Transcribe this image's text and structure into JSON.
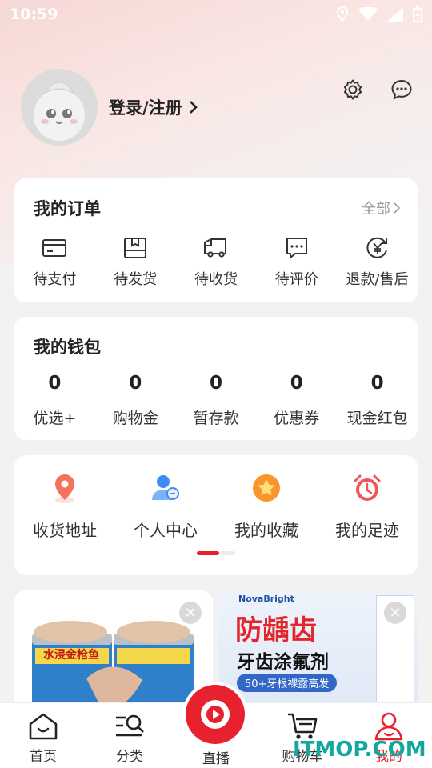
{
  "status": {
    "time": "10:59"
  },
  "profile": {
    "login_label": "登录/注册"
  },
  "orders": {
    "title": "我的订单",
    "all_label": "全部",
    "items": [
      {
        "label": "待支付",
        "icon": "wallet-card-icon"
      },
      {
        "label": "待发货",
        "icon": "package-box-icon"
      },
      {
        "label": "待收货",
        "icon": "truck-icon"
      },
      {
        "label": "待评价",
        "icon": "comment-icon"
      },
      {
        "label": "退款/售后",
        "icon": "refund-yen-icon"
      }
    ]
  },
  "wallet": {
    "title": "我的钱包",
    "items": [
      {
        "value": "0",
        "label": "优选+"
      },
      {
        "value": "0",
        "label": "购物金"
      },
      {
        "value": "0",
        "label": "暂存款"
      },
      {
        "value": "0",
        "label": "优惠券"
      },
      {
        "value": "0",
        "label": "现金红包"
      }
    ]
  },
  "shortcuts": {
    "items": [
      {
        "label": "收货地址",
        "icon": "location-pin-icon"
      },
      {
        "label": "个人中心",
        "icon": "user-profile-icon"
      },
      {
        "label": "我的收藏",
        "icon": "star-favorite-icon"
      },
      {
        "label": "我的足迹",
        "icon": "alarm-clock-icon"
      }
    ]
  },
  "products": [
    {
      "title_text": "水浸金枪鱼"
    },
    {
      "brand": "NovaBright",
      "headline": "防龋齿",
      "sub": "牙齿涂氟剂",
      "tag": "50+牙根裸露高发"
    }
  ],
  "tabbar": {
    "tabs": [
      {
        "label": "首页",
        "icon": "home-icon"
      },
      {
        "label": "分类",
        "icon": "category-search-icon"
      },
      {
        "label": "直播",
        "icon": "live-play-icon"
      },
      {
        "label": "购物车",
        "icon": "cart-icon"
      },
      {
        "label": "我的",
        "icon": "me-person-icon"
      }
    ],
    "active": "我的"
  },
  "watermark": "ITMOP.COM",
  "colors": {
    "accent": "#e8212e",
    "watermark": "#12a89d"
  }
}
